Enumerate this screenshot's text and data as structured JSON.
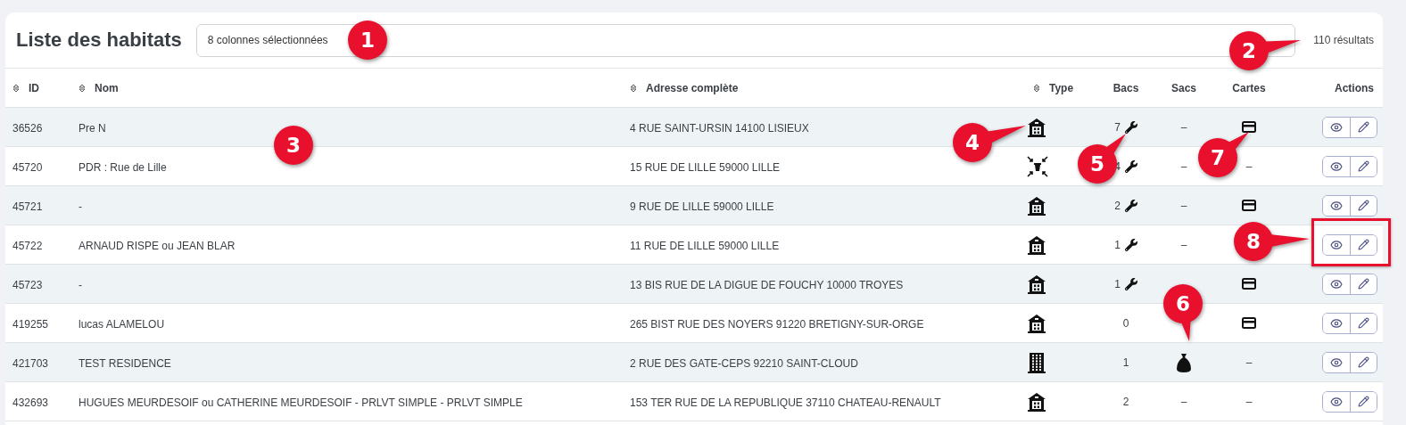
{
  "title": "Liste des habitats",
  "column_select": {
    "value": "8 colonnes sélectionnées"
  },
  "result_count": "110 résultats",
  "columns": [
    {
      "label": "ID",
      "sortable": true
    },
    {
      "label": "Nom",
      "sortable": true
    },
    {
      "label": "Adresse complète",
      "sortable": true
    },
    {
      "label": "Type",
      "sortable": true
    },
    {
      "label": "Bacs",
      "sortable": false
    },
    {
      "label": "Sacs",
      "sortable": false
    },
    {
      "label": "Cartes",
      "sortable": false
    },
    {
      "label": "Actions",
      "sortable": false
    }
  ],
  "rows": [
    {
      "id": "36526",
      "nom": "Pre N",
      "adresse": "4 RUE SAINT-URSIN 14100 LISIEUX",
      "type": {
        "kind": "house"
      },
      "bacs": "7",
      "maintenance": true,
      "sacs": {
        "kind": "text",
        "text": "–"
      },
      "cartes": {
        "kind": "card"
      }
    },
    {
      "id": "45720",
      "nom": "PDR : Rue de Lille",
      "adresse": "15 RUE DE LILLE 59000 LILLE",
      "type": {
        "kind": "compactor"
      },
      "bacs": "4",
      "maintenance": true,
      "sacs": {
        "kind": "text",
        "text": "–"
      },
      "cartes": {
        "kind": "text",
        "text": "–"
      }
    },
    {
      "id": "45721",
      "nom": "-",
      "adresse": "9 RUE DE LILLE 59000 LILLE",
      "type": {
        "kind": "house"
      },
      "bacs": "2",
      "maintenance": true,
      "sacs": {
        "kind": "text",
        "text": "–"
      },
      "cartes": {
        "kind": "card"
      }
    },
    {
      "id": "45722",
      "nom": "ARNAUD RISPE ou JEAN BLAR",
      "adresse": "11 RUE DE LILLE 59000 LILLE",
      "type": {
        "kind": "house"
      },
      "bacs": "1",
      "maintenance": true,
      "sacs": {
        "kind": "text",
        "text": "–"
      },
      "cartes": {
        "kind": "none"
      }
    },
    {
      "id": "45723",
      "nom": "-",
      "adresse": "13 BIS RUE DE LA DIGUE DE FOUCHY 10000 TROYES",
      "type": {
        "kind": "house"
      },
      "bacs": "1",
      "maintenance": true,
      "sacs": {
        "kind": "none"
      },
      "cartes": {
        "kind": "card"
      }
    },
    {
      "id": "419255",
      "nom": "lucas ALAMELOU",
      "adresse": "265 BIST RUE DES NOYERS 91220 BRETIGNY-SUR-ORGE",
      "type": {
        "kind": "house"
      },
      "bacs": "0",
      "maintenance": false,
      "sacs": {
        "kind": "none"
      },
      "cartes": {
        "kind": "card"
      }
    },
    {
      "id": "421703",
      "nom": "TEST RESIDENCE",
      "adresse": "2 RUE DES GATE-CEPS 92210 SAINT-CLOUD",
      "type": {
        "kind": "building"
      },
      "bacs": "1",
      "maintenance": false,
      "sacs": {
        "kind": "bag"
      },
      "cartes": {
        "kind": "text",
        "text": "–"
      }
    },
    {
      "id": "432693",
      "nom": "HUGUES MEURDESOIF ou CATHERINE MEURDESOIF - PRLVT SIMPLE - PRLVT SIMPLE",
      "adresse": "153 TER RUE DE LA REPUBLIQUE 37110 CHATEAU-RENAULT",
      "type": {
        "kind": "house"
      },
      "bacs": "2",
      "maintenance": false,
      "sacs": {
        "kind": "text",
        "text": "–"
      },
      "cartes": {
        "kind": "text",
        "text": "–"
      }
    }
  ],
  "annotations": [
    {
      "number": "1",
      "kind": "badge"
    },
    {
      "number": "2",
      "kind": "badge"
    },
    {
      "number": "3",
      "kind": "badge"
    },
    {
      "number": "4",
      "kind": "badge"
    },
    {
      "number": "5",
      "kind": "badge"
    },
    {
      "number": "6",
      "kind": "badge"
    },
    {
      "number": "7",
      "kind": "badge"
    },
    {
      "number": "8",
      "kind": "badge"
    },
    {
      "kind": "frame"
    }
  ]
}
